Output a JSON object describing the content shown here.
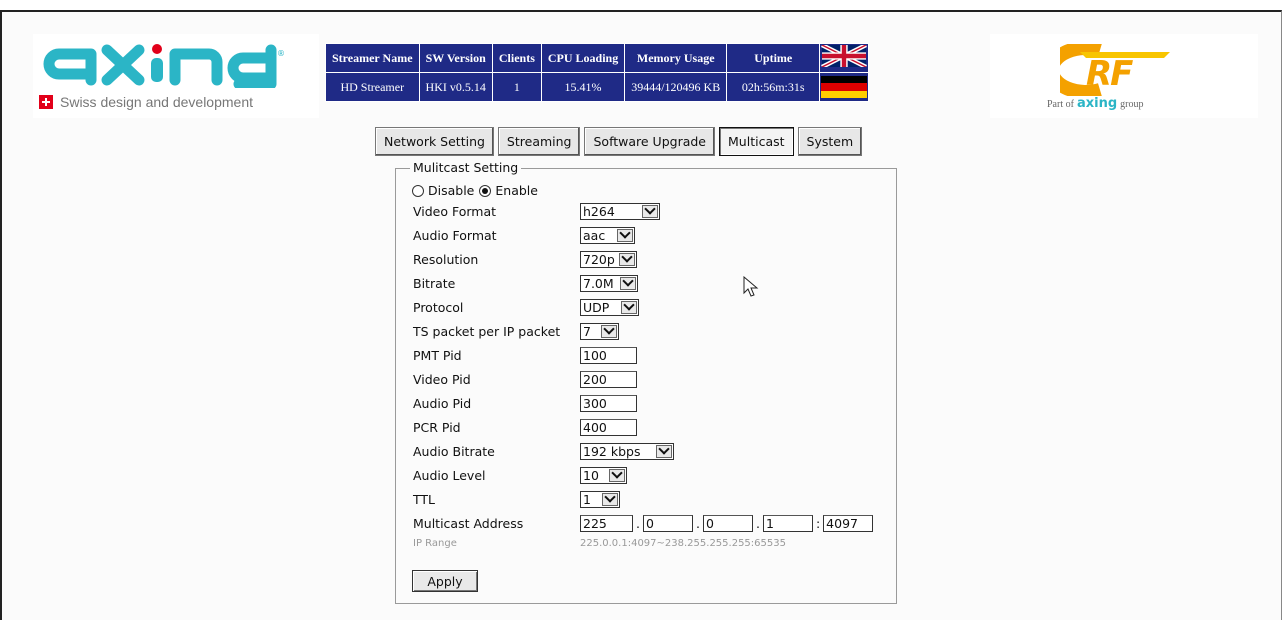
{
  "brand": {
    "left_logo_text": "axing",
    "tagline": "Swiss design and development",
    "right_logo_text": "RF",
    "part_of_prefix": "Part of",
    "part_of_brand": "axing",
    "part_of_suffix": "group"
  },
  "status_table": {
    "headers": [
      "Streamer Name",
      "SW Version",
      "Clients",
      "CPU Loading",
      "Memory Usage",
      "Uptime"
    ],
    "values": [
      "HD Streamer",
      "HKI v0.5.14",
      "1",
      "15.41%",
      "39444/120496 KB",
      "02h:56m:31s"
    ],
    "languages": [
      "English",
      "Deutsch"
    ]
  },
  "tabs": [
    {
      "label": "Network Setting",
      "active": false
    },
    {
      "label": "Streaming",
      "active": false
    },
    {
      "label": "Software Upgrade",
      "active": false
    },
    {
      "label": "Multicast",
      "active": true
    },
    {
      "label": "System",
      "active": false
    }
  ],
  "multicast": {
    "legend": "Mulitcast Setting",
    "disable_label": "Disable",
    "enable_label": "Enable",
    "enabled": true,
    "fields": {
      "video_format": {
        "label": "Video Format",
        "value": "h264"
      },
      "audio_format": {
        "label": "Audio Format",
        "value": "aac"
      },
      "resolution": {
        "label": "Resolution",
        "value": "720p"
      },
      "bitrate": {
        "label": "Bitrate",
        "value": "7.0M"
      },
      "protocol": {
        "label": "Protocol",
        "value": "UDP"
      },
      "ts_packet": {
        "label": "TS packet per IP packet",
        "value": "7"
      },
      "pmt_pid": {
        "label": "PMT Pid",
        "value": "100"
      },
      "video_pid": {
        "label": "Video Pid",
        "value": "200"
      },
      "audio_pid": {
        "label": "Audio Pid",
        "value": "300"
      },
      "pcr_pid": {
        "label": "PCR Pid",
        "value": "400"
      },
      "audio_bitrate": {
        "label": "Audio Bitrate",
        "value": "192 kbps"
      },
      "audio_level": {
        "label": "Audio Level",
        "value": "10"
      },
      "ttl": {
        "label": "TTL",
        "value": "1"
      }
    },
    "multicast_address": {
      "label": "Multicast Address",
      "octet1": "225",
      "octet2": "0",
      "octet3": "0",
      "octet4": "1",
      "port": "4097"
    },
    "ip_range_label": "IP Range",
    "ip_range_value": "225.0.0.1:4097~238.255.255.255:65535",
    "apply_label": "Apply"
  },
  "colors": {
    "header_blue": "#1f2a86",
    "axing_teal": "#2bb5c6",
    "rf_orange": "#f4a100",
    "swiss_red": "#e2001a"
  }
}
